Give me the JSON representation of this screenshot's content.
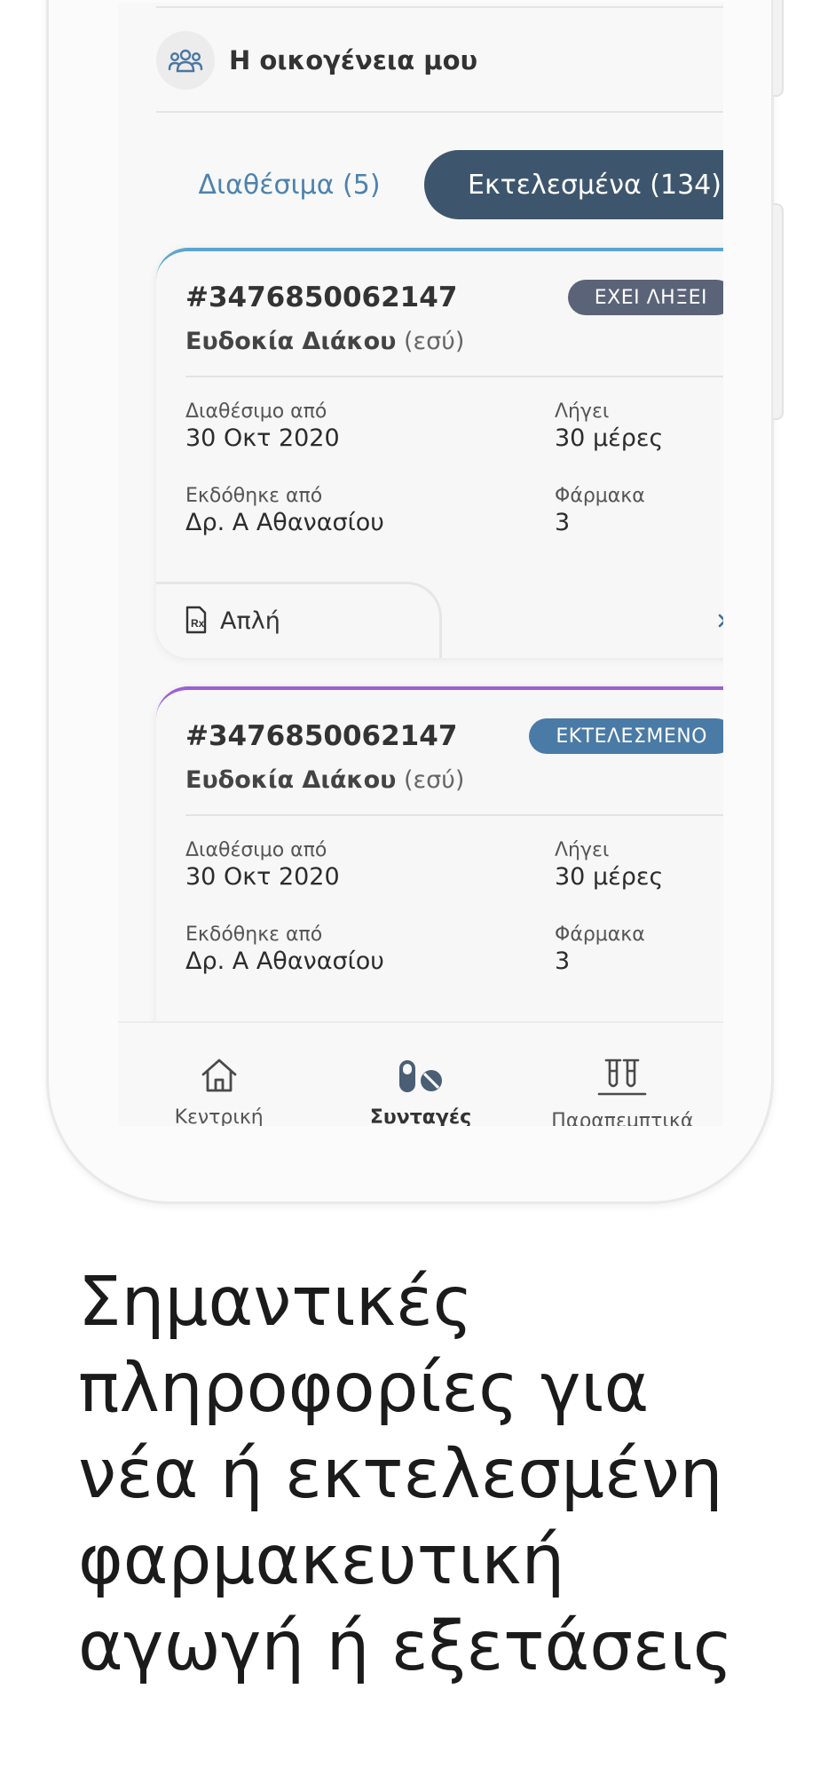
{
  "family": {
    "label": "Η οικογένεια μου",
    "icon": "family-icon"
  },
  "tabs": [
    {
      "label": "Διαθέσιμα (5)",
      "active": false
    },
    {
      "label": "Εκτελεσμένα (134)",
      "active": true
    }
  ],
  "cards": [
    {
      "number": "#3476850062147",
      "status": "ΕΧΕΙ ΛΗΞΕΙ",
      "patient_name": "Ευδοκία Διάκου",
      "patient_suffix": "(εσύ)",
      "available_from_label": "Διαθέσιμο από",
      "available_from": "30 Οκτ 2020",
      "expires_label": "Λήγει",
      "expires": "30 μέρες",
      "issued_by_label": "Εκδόθηκε από",
      "issued_by": "Δρ. Α Αθανασίου",
      "drugs_label": "Φάρμακα",
      "drugs": "3",
      "type_label": "Απλή"
    },
    {
      "number": "#3476850062147",
      "status": "ΕΚΤΕΛΕΣΜΕΝΟ",
      "patient_name": "Ευδοκία Διάκου",
      "patient_suffix": "(εσύ)",
      "available_from_label": "Διαθέσιμο από",
      "available_from": "30 Οκτ 2020",
      "expires_label": "Λήγει",
      "expires": "30 μέρες",
      "issued_by_label": "Εκδόθηκε από",
      "issued_by": "Δρ. Α Αθανασίου",
      "drugs_label": "Φάρμακα",
      "drugs": "3"
    }
  ],
  "nav": [
    {
      "label": "Κεντρική",
      "icon": "home-icon",
      "active": false
    },
    {
      "label": "Συνταγές",
      "icon": "pills-icon",
      "active": true
    },
    {
      "label": "Παραπεμπτικά",
      "icon": "test-tubes-icon",
      "active": false
    }
  ],
  "headline": {
    "line1": "Σημαντικές",
    "line2": "πληροφορίες για",
    "line3": "νέα ή εκτελεσμένη",
    "line4": "φαρμακευτική",
    "line5": "αγωγή ή εξετάσεις"
  },
  "colors": {
    "tab_active_bg": "#3e566d",
    "tab_inactive_text": "#4d82ad",
    "badge_expired": "#5b6378",
    "badge_executed": "#4a7aa6",
    "card1_accent": "#5aa6cf",
    "card2_accent": "#9b5fd6"
  }
}
